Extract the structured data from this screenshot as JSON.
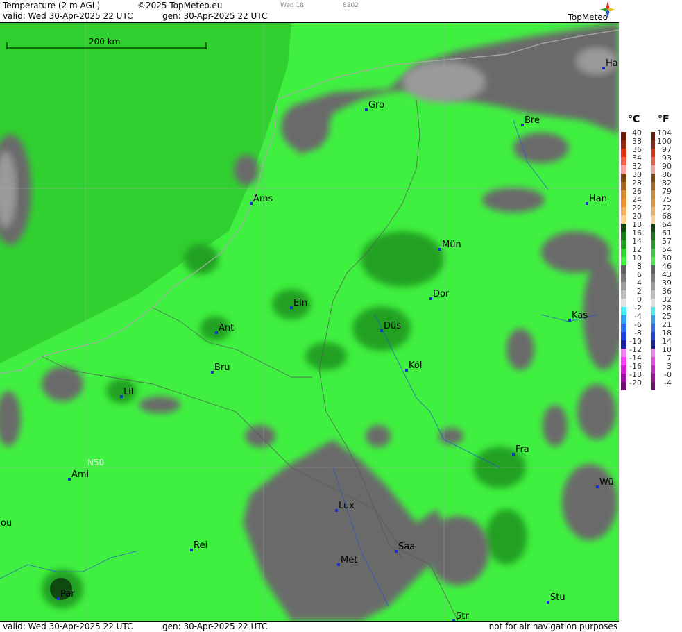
{
  "header": {
    "title": "Temperature (2 m AGL)",
    "copyright": "©2025 TopMeteo.eu",
    "day_tag": "Wed 18",
    "code": "8202",
    "valid": "valid:  Wed  30-Apr-2025  22 UTC",
    "gen": "gen:  30-Apr-2025  22 UTC",
    "brand": "TopMeteo"
  },
  "footer": {
    "valid": "valid:  Wed  30-Apr-2025  22 UTC",
    "gen": "gen:  30-Apr-2025  22 UTC",
    "note": "not for air navigation purposes"
  },
  "map": {
    "scale_label": "200 km",
    "grid_label": "N50",
    "cities": [
      {
        "name": "Ha"
      },
      {
        "name": "Gro"
      },
      {
        "name": "Bre"
      },
      {
        "name": "Ams"
      },
      {
        "name": "Han"
      },
      {
        "name": "Mün"
      },
      {
        "name": "Dor"
      },
      {
        "name": "Ein"
      },
      {
        "name": "Düs"
      },
      {
        "name": "Ant"
      },
      {
        "name": "Kas"
      },
      {
        "name": "Bru"
      },
      {
        "name": "Köl"
      },
      {
        "name": "Lil"
      },
      {
        "name": "Fra"
      },
      {
        "name": "Ami"
      },
      {
        "name": "Wü"
      },
      {
        "name": "Lux"
      },
      {
        "name": "ou"
      },
      {
        "name": "Saa"
      },
      {
        "name": "Rei"
      },
      {
        "name": "Met"
      },
      {
        "name": "Par"
      },
      {
        "name": "Stu"
      },
      {
        "name": "Str"
      }
    ]
  },
  "legend": {
    "unit_c": "°C",
    "unit_f": "°F",
    "celsius": [
      "40",
      "38",
      "36",
      "34",
      "32",
      "30",
      "28",
      "26",
      "24",
      "22",
      "20",
      "18",
      "16",
      "14",
      "12",
      "10",
      "8",
      "6",
      "4",
      "2",
      "0",
      "-2",
      "-4",
      "-6",
      "-8",
      "-10",
      "-12",
      "-14",
      "-16",
      "-18",
      "-20"
    ],
    "fahrenheit": [
      "104",
      "100",
      "97",
      "93",
      "90",
      "86",
      "82",
      "79",
      "75",
      "72",
      "68",
      "64",
      "61",
      "57",
      "54",
      "50",
      "46",
      "43",
      "39",
      "36",
      "32",
      "28",
      "25",
      "21",
      "18",
      "14",
      "10",
      "7",
      "3",
      "-0",
      "-4"
    ],
    "colors": [
      "#6b1a0a",
      "#8e2a12",
      "#e03010",
      "#f06048",
      "#f6a0a0",
      "#7a4a10",
      "#a86a20",
      "#d08a30",
      "#e89030",
      "#f0b060",
      "#f8d090",
      "#104a10",
      "#1a7a1a",
      "#20a020",
      "#30d030",
      "#40f040",
      "#606060",
      "#7a7a7a",
      "#9a9a9a",
      "#bcbcbc",
      "#e0e0e0",
      "#40f0f0",
      "#30a0f0",
      "#3070f0",
      "#2040e0",
      "#1a20a0",
      "#f080f0",
      "#f040f0",
      "#d020d0",
      "#a010a0",
      "#701070"
    ]
  }
}
